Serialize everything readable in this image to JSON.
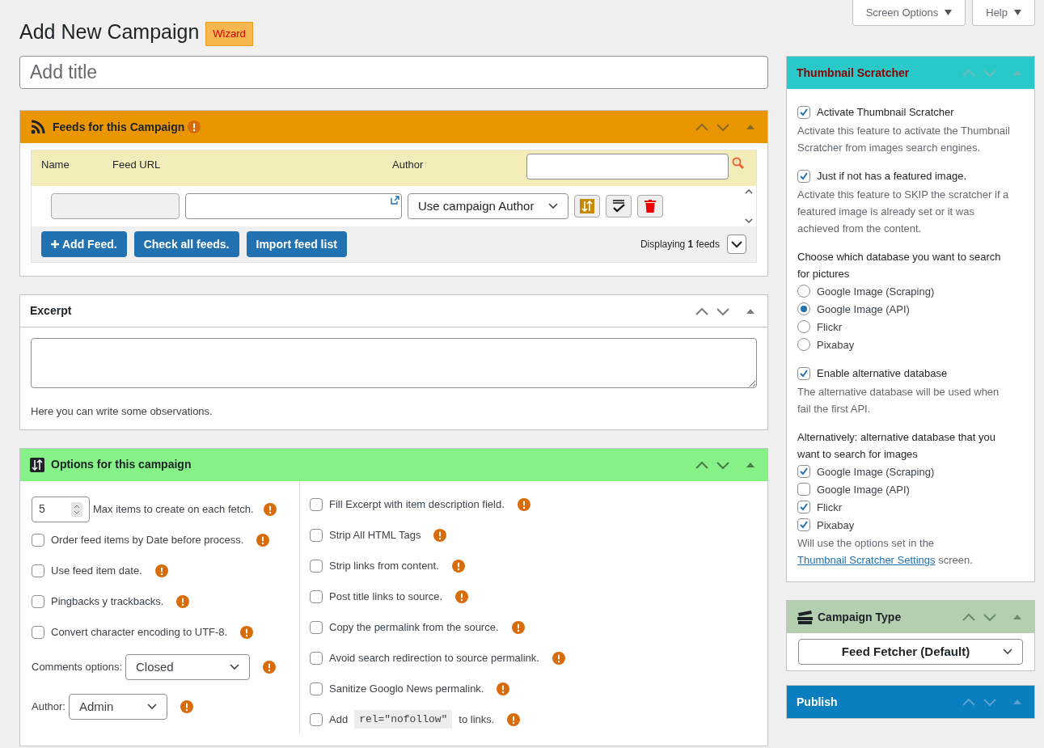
{
  "page": {
    "title": "Add New Campaign",
    "badge": "Wizard",
    "title_placeholder": "Add title"
  },
  "top_tabs": [
    "Screen Options",
    "Help"
  ],
  "feeds": {
    "title": "Feeds for this Campaign",
    "columns": [
      "Name",
      "Feed URL",
      "Author"
    ],
    "row": {
      "author": "Use campaign Author"
    },
    "buttons": [
      {
        "label": "Add Feed.",
        "kind": "add"
      },
      {
        "label": "Check all feeds.",
        "kind": "plain"
      },
      {
        "label": "Import feed list",
        "kind": "plain"
      }
    ],
    "count": "Displaying **1** feeds"
  },
  "excerpt": {
    "title": "Excerpt",
    "hint": "Here you can write some observations."
  },
  "options": {
    "title": "Options for this campaign",
    "left": [
      {
        "kind": "number",
        "value": "5",
        "label": "Max items to create on each fetch."
      },
      {
        "kind": "checkbox",
        "label": "Order feed items by Date before process.",
        "checked": false
      },
      {
        "kind": "checkbox",
        "label": "Use feed item date.",
        "checked": false
      },
      {
        "kind": "checkbox",
        "label": "Pingbacks y trackbacks.",
        "checked": false
      },
      {
        "kind": "checkbox",
        "label": "Convert character encoding to UTF-8.",
        "checked": false
      },
      {
        "kind": "select",
        "label": "Comments options:",
        "value": "Closed"
      },
      {
        "kind": "select",
        "label": "Author:",
        "value": "Admin"
      }
    ],
    "right": [
      {
        "kind": "checkbox",
        "label": "Fill Excerpt with item description field.",
        "checked": false
      },
      {
        "kind": "checkbox",
        "label": "Strip All HTML Tags",
        "checked": false
      },
      {
        "kind": "checkbox",
        "label": "Strip links from content.",
        "checked": false
      },
      {
        "kind": "checkbox",
        "label": "Post title links to source.",
        "checked": false
      },
      {
        "kind": "checkbox",
        "label": "Copy the permalink from the source.",
        "checked": false
      },
      {
        "kind": "checkbox",
        "label": "Avoid search redirection to source permalink.",
        "checked": false
      },
      {
        "kind": "checkbox",
        "label": "Sanitize Googlo News permalink.",
        "checked": false
      },
      {
        "kind": "code",
        "checked": false,
        "parts": [
          "Add",
          "rel=\"nofollow\"",
          "to links."
        ]
      }
    ]
  },
  "thumbnail": {
    "title": "Thumbnail Scratcher",
    "toggles": [
      {
        "label": "Activate Thumbnail Scratcher",
        "checked": true,
        "desc": "Activate this feature to activate the Thumbnail Scratcher from images search engines."
      },
      {
        "label": "Just if not has a featured image.",
        "checked": true,
        "desc": "Activate this feature to SKIP the scratcher if a featured image is already set or it was achieved from the content."
      }
    ],
    "db_heading": "Choose which database you want to search for pictures",
    "db": [
      {
        "label": "Google Image (Scraping)",
        "selected": false
      },
      {
        "label": "Google Image (API)",
        "selected": true
      },
      {
        "label": "Flickr",
        "selected": false
      },
      {
        "label": "Pixabay",
        "selected": false
      }
    ],
    "alt_toggle": {
      "label": "Enable alternative database",
      "checked": true,
      "desc": "The alternative database will be used when fail the first API."
    },
    "alt_heading": "Alternatively: alternative database that you want to search for images",
    "alt_db": [
      {
        "label": "Google Image (Scraping)",
        "checked": true
      },
      {
        "label": "Google Image (API)",
        "checked": false
      },
      {
        "label": "Flickr",
        "checked": true
      },
      {
        "label": "Pixabay",
        "checked": true
      }
    ],
    "note": {
      "before": "Will use the options set in the",
      "link": "Thumbnail Scratcher Settings",
      "after": "screen."
    }
  },
  "campaign_type": {
    "title": "Campaign Type",
    "value": "Feed Fetcher (Default)"
  },
  "publish": {
    "title": "Publish"
  }
}
